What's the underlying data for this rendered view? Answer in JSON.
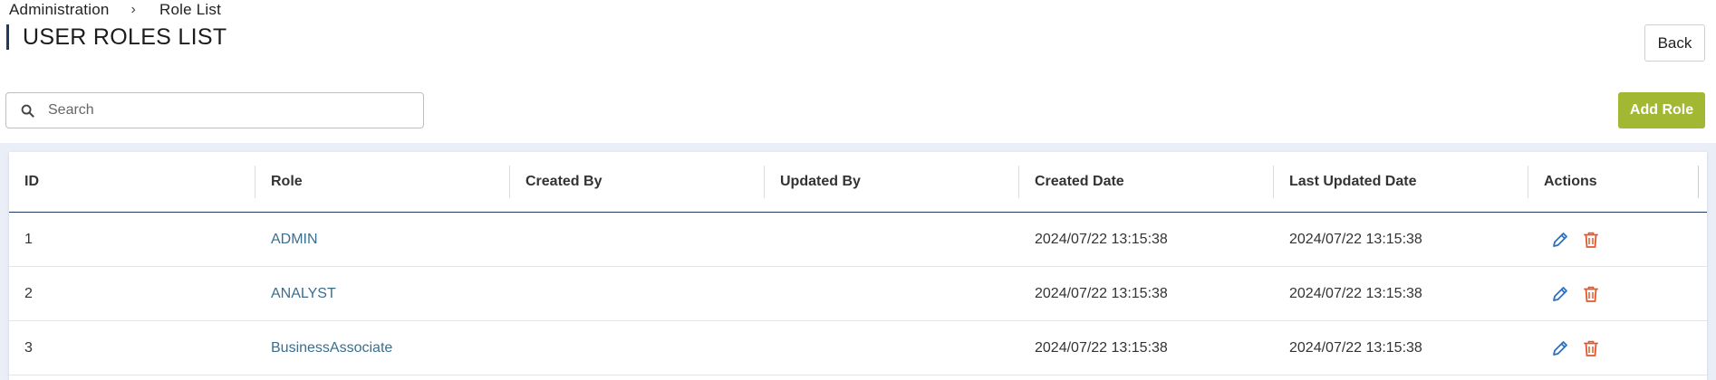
{
  "breadcrumb": {
    "parent": "Administration",
    "separator": "›",
    "current": "Role List"
  },
  "page": {
    "title": "USER ROLES LIST"
  },
  "toolbar": {
    "back_label": "Back",
    "add_role_label": "Add Role",
    "search_placeholder": "Search",
    "search_value": ""
  },
  "table": {
    "headers": [
      "ID",
      "Role",
      "Created By",
      "Updated By",
      "Created Date",
      "Last Updated Date",
      "Actions"
    ],
    "rows": [
      {
        "id": "1",
        "role": "ADMIN",
        "created_by": "",
        "updated_by": "",
        "created_date": "2024/07/22 13:15:38",
        "updated_date": "2024/07/22 13:15:38"
      },
      {
        "id": "2",
        "role": "ANALYST",
        "created_by": "",
        "updated_by": "",
        "created_date": "2024/07/22 13:15:38",
        "updated_date": "2024/07/22 13:15:38"
      },
      {
        "id": "3",
        "role": "BusinessAssociate",
        "created_by": "",
        "updated_by": "",
        "created_date": "2024/07/22 13:15:38",
        "updated_date": "2024/07/22 13:15:38"
      }
    ]
  },
  "icons": {
    "search": "search-icon",
    "edit": "pencil-icon",
    "delete": "trash-icon"
  },
  "colors": {
    "accent": "#a2b832",
    "title_bar": "#1f3a5f",
    "link": "#3a6e8f",
    "edit_icon": "#2f6fc0",
    "delete_icon": "#e2572b",
    "table_background": "#e9eef7"
  }
}
